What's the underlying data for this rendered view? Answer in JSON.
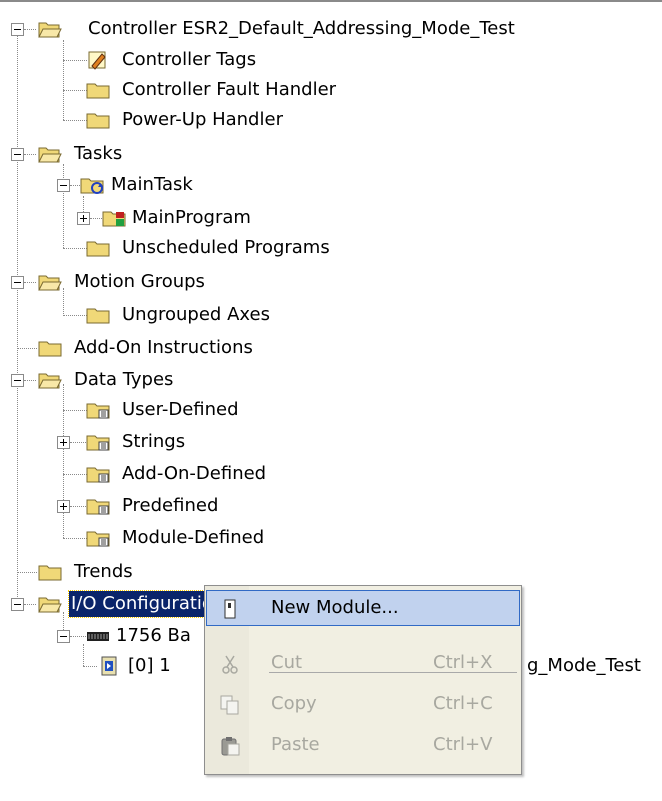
{
  "tree": {
    "controller": "Controller ESR2_Default_Addressing_Mode_Test",
    "controller_tags": "Controller Tags",
    "controller_fault_handler": "Controller Fault Handler",
    "powerup_handler": "Power-Up Handler",
    "tasks": "Tasks",
    "main_task": "MainTask",
    "main_program": "MainProgram",
    "unscheduled_programs": "Unscheduled Programs",
    "motion_groups": "Motion Groups",
    "ungrouped_axes": "Ungrouped Axes",
    "addon_instructions": "Add-On Instructions",
    "data_types": "Data Types",
    "user_defined": "User-Defined",
    "strings": "Strings",
    "addon_defined": "Add-On-Defined",
    "predefined": "Predefined",
    "module_defined": "Module-Defined",
    "trends": "Trends",
    "io_configuration": "I/O Configuration",
    "backplane": "1756 Ba",
    "module_slot": "[0] 1",
    "module_tail": "g_Mode_Test"
  },
  "context_menu": {
    "new_module": "New Module...",
    "cut": "Cut",
    "cut_key": "Ctrl+X",
    "copy": "Copy",
    "copy_key": "Ctrl+C",
    "paste": "Paste",
    "paste_key": "Ctrl+V"
  },
  "colors": {
    "folder": "#f0d878",
    "selection": "#0a246a",
    "menu_hover": "#c1d2ee",
    "menu_bg": "#f1efe2"
  }
}
